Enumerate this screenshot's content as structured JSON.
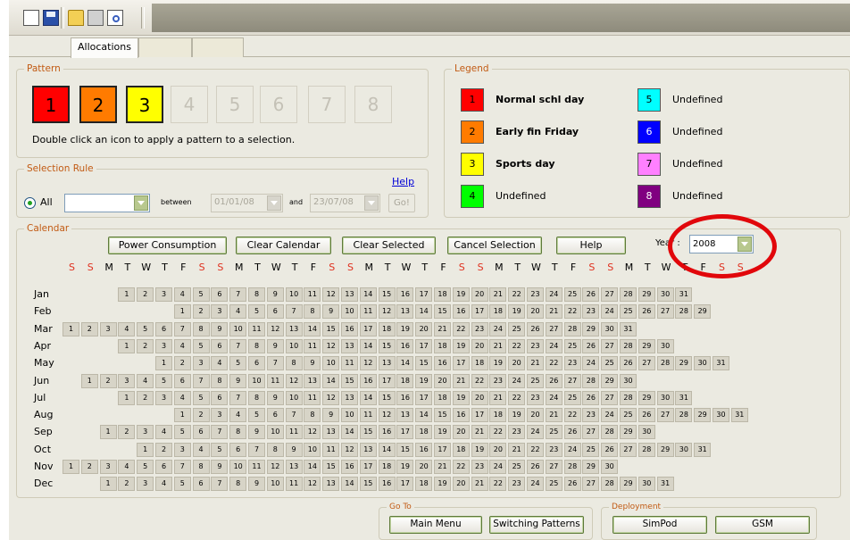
{
  "toolbar": {
    "icons": [
      "new-document-icon",
      "save-icon",
      "open-folder-icon",
      "print-icon",
      "print-preview-icon"
    ]
  },
  "tabs": [
    "Allocations",
    "",
    ""
  ],
  "pattern": {
    "label": "Pattern",
    "buttons": [
      {
        "label": "1",
        "color": "#ff0000",
        "enabled": true
      },
      {
        "label": "2",
        "color": "#ff7b00",
        "enabled": true
      },
      {
        "label": "3",
        "color": "#ffff00",
        "enabled": true
      },
      {
        "label": "4",
        "enabled": false
      },
      {
        "label": "5",
        "enabled": false
      },
      {
        "label": "6",
        "enabled": false
      },
      {
        "label": "7",
        "enabled": false
      },
      {
        "label": "8",
        "enabled": false
      }
    ],
    "hint": "Double click an icon to apply a pattern to a selection."
  },
  "legend": {
    "label": "Legend",
    "items": [
      {
        "num": "1",
        "color": "#ff0000",
        "text": "Normal schl day",
        "bold": true,
        "textColor": "#000"
      },
      {
        "num": "2",
        "color": "#ff7b00",
        "text": "Early fin Friday",
        "bold": true,
        "textColor": "#000"
      },
      {
        "num": "3",
        "color": "#ffff00",
        "text": "Sports day",
        "bold": true,
        "textColor": "#000"
      },
      {
        "num": "4",
        "color": "#00ff00",
        "text": "Undefined",
        "bold": false,
        "textColor": "#000"
      },
      {
        "num": "5",
        "color": "#00ffff",
        "text": "Undefined",
        "bold": false,
        "textColor": "#000"
      },
      {
        "num": "6",
        "color": "#0000ff",
        "text": "Undefined",
        "bold": false,
        "textColor": "#fff"
      },
      {
        "num": "7",
        "color": "#ff80ff",
        "text": "Undefined",
        "bold": false,
        "textColor": "#000"
      },
      {
        "num": "8",
        "color": "#800080",
        "text": "Undefined",
        "bold": false,
        "textColor": "#fff"
      }
    ]
  },
  "selection_rule": {
    "label": "Selection Rule",
    "help": "Help",
    "all_label": "All",
    "rule_value": "",
    "between": "between",
    "from_date": "01/01/08",
    "and": "and",
    "to_date": "23/07/08",
    "go": "Go!"
  },
  "calendar": {
    "label": "Calendar",
    "buttons": [
      "Power Consumption",
      "Clear Calendar",
      "Clear Selected",
      "Cancel Selection",
      "Help"
    ],
    "year_label": "Year :",
    "year": "2008",
    "dow": [
      "S",
      "S",
      "M",
      "T",
      "W",
      "T",
      "F",
      "S",
      "S",
      "M",
      "T",
      "W",
      "T",
      "F",
      "S",
      "S",
      "M",
      "T",
      "W",
      "T",
      "F",
      "S",
      "S",
      "M",
      "T",
      "W",
      "T",
      "F",
      "S",
      "S",
      "M",
      "T",
      "W",
      "T",
      "F",
      "S",
      "S"
    ],
    "months": [
      {
        "name": "Jan",
        "start": 3,
        "days": 31
      },
      {
        "name": "Feb",
        "start": 6,
        "days": 29
      },
      {
        "name": "Mar",
        "start": 0,
        "days": 31
      },
      {
        "name": "Apr",
        "start": 3,
        "days": 30
      },
      {
        "name": "May",
        "start": 5,
        "days": 31
      },
      {
        "name": "Jun",
        "start": 1,
        "days": 30
      },
      {
        "name": "Jul",
        "start": 3,
        "days": 31
      },
      {
        "name": "Aug",
        "start": 6,
        "days": 31
      },
      {
        "name": "Sep",
        "start": 2,
        "days": 30
      },
      {
        "name": "Oct",
        "start": 4,
        "days": 31
      },
      {
        "name": "Nov",
        "start": 0,
        "days": 30
      },
      {
        "name": "Dec",
        "start": 2,
        "days": 31
      }
    ]
  },
  "goto": {
    "label": "Go To",
    "buttons": [
      "Main Menu",
      "Switching Patterns"
    ]
  },
  "deployment": {
    "label": "Deployment",
    "buttons": [
      "SimPod",
      "GSM"
    ]
  }
}
